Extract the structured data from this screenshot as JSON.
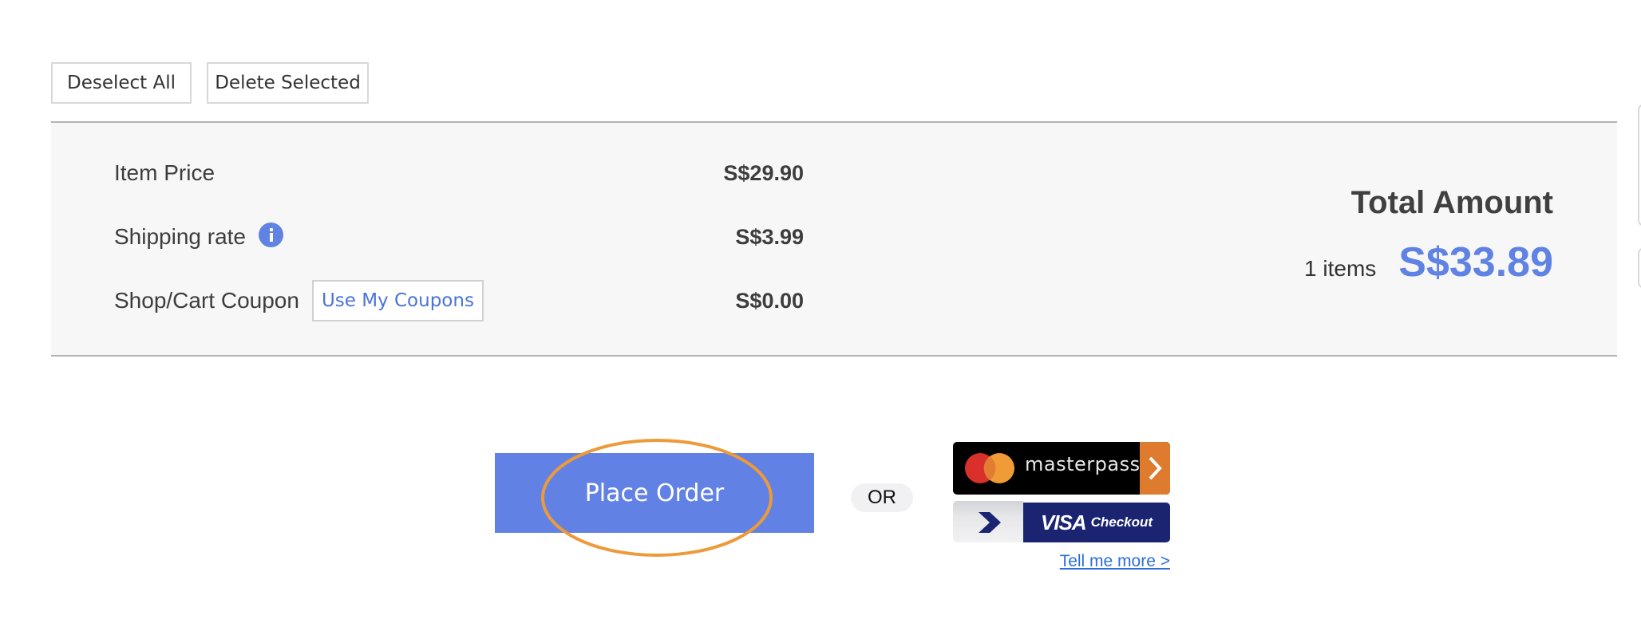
{
  "toolbar": {
    "deselect_all_label": "Deselect All",
    "delete_selected_label": "Delete Selected"
  },
  "summary": {
    "rows": [
      {
        "label": "Item Price",
        "value": "S$29.90"
      },
      {
        "label": "Shipping rate",
        "value": "S$3.99",
        "icon": "info-icon"
      },
      {
        "label": "Shop/Cart Coupon",
        "value": "S$0.00",
        "action_label": "Use My Coupons"
      }
    ],
    "total_title": "Total Amount",
    "items_count": "1 items",
    "total_value": "S$33.89"
  },
  "checkout": {
    "place_order_label": "Place Order",
    "or_label": "OR",
    "masterpass_label": "masterpass",
    "visa_label": "VISA",
    "visa_checkout_label": "Checkout",
    "tell_more_label": "Tell me more >"
  },
  "colors": {
    "accent": "#6182e4",
    "highlight": "#ec9a3a",
    "masterpass_orange": "#de7b2e",
    "visa_navy": "#1b2471"
  }
}
